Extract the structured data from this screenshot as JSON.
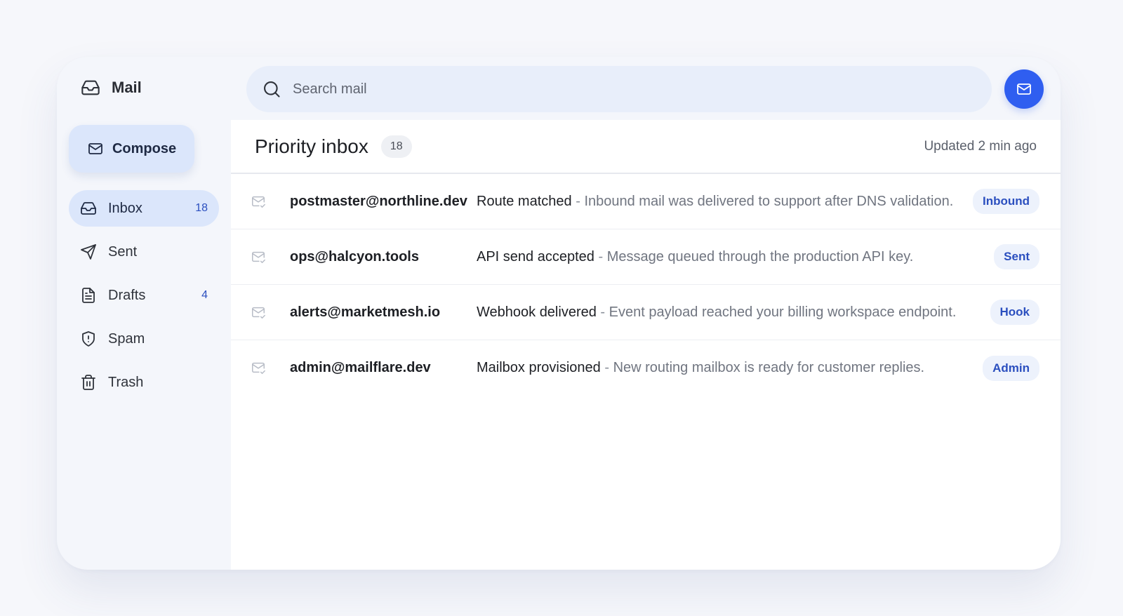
{
  "app": {
    "name": "Mail"
  },
  "search": {
    "placeholder": "Search mail"
  },
  "compose": {
    "label": "Compose"
  },
  "nav": [
    {
      "label": "Inbox",
      "count": "18",
      "icon": "inbox-icon",
      "active": true
    },
    {
      "label": "Sent",
      "count": "",
      "icon": "send-icon",
      "active": false
    },
    {
      "label": "Drafts",
      "count": "4",
      "icon": "file-icon",
      "active": false
    },
    {
      "label": "Spam",
      "count": "",
      "icon": "shield-alert-icon",
      "active": false
    },
    {
      "label": "Trash",
      "count": "",
      "icon": "trash-icon",
      "active": false
    }
  ],
  "main": {
    "title": "Priority inbox",
    "count": "18",
    "updated": "Updated 2 min ago",
    "separator": "-",
    "messages": [
      {
        "sender": "postmaster@northline.dev",
        "subject": "Route matched",
        "snippet": "Inbound mail was delivered to support after DNS validation.",
        "tag": "Inbound"
      },
      {
        "sender": "ops@halcyon.tools",
        "subject": "API send accepted",
        "snippet": "Message queued through the production API key.",
        "tag": "Sent"
      },
      {
        "sender": "alerts@marketmesh.io",
        "subject": "Webhook delivered",
        "snippet": "Event payload reached your billing workspace endpoint.",
        "tag": "Hook"
      },
      {
        "sender": "admin@mailflare.dev",
        "subject": "Mailbox provisioned",
        "snippet": "New routing mailbox is ready for customer replies.",
        "tag": "Admin"
      }
    ]
  },
  "colors": {
    "accent": "#2f5ef0",
    "active_bg": "#dbe6fb",
    "tag_text": "#2b4fbf"
  }
}
